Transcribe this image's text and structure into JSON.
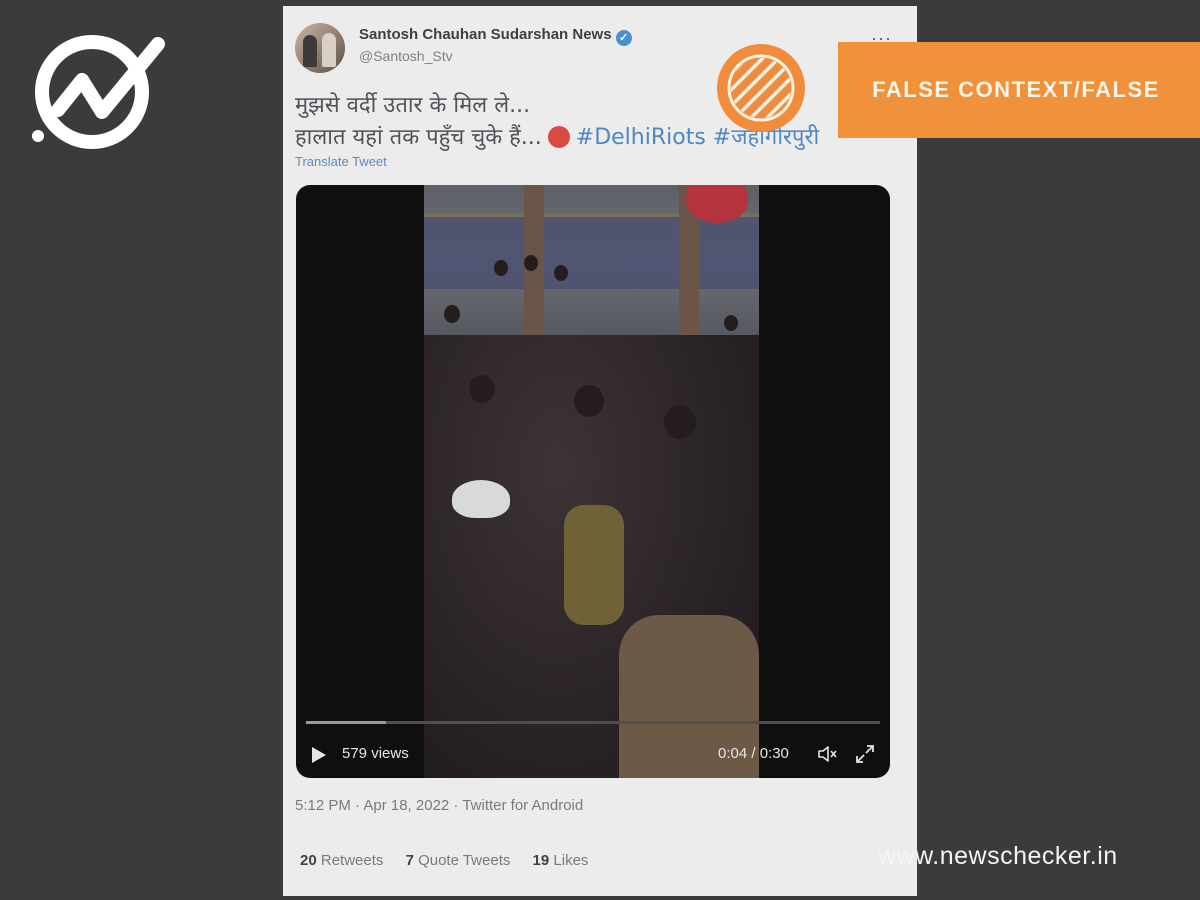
{
  "tweet": {
    "author_name": "Santosh Chauhan Sudarshan News",
    "handle": "@Santosh_Stv",
    "more_label": "···",
    "text_line1": "मुझसे वर्दी उतार के मिल ले...",
    "text_line2": "हालात यहां तक पहुँच चुके हैं...",
    "hashtag1": "#DelhiRiots",
    "hashtag2": "#जहांगीरपुरी",
    "translate_label": "Translate Tweet",
    "video": {
      "views": "579 views",
      "time": "0:04 / 0:30",
      "progress": 0.14
    },
    "meta": "5:12 PM · Apr 18, 2022 · Twitter for Android",
    "stats": {
      "retweets_count": "20",
      "retweets_label": "Retweets",
      "quotes_count": "7",
      "quotes_label": "Quote Tweets",
      "likes_count": "19",
      "likes_label": "Likes"
    }
  },
  "verdict": {
    "label": "FALSE CONTEXT/FALSE",
    "color": "#f0913c"
  },
  "site_url": "www.newschecker.in",
  "icons": [
    "newschecker-logo-icon",
    "verified-icon",
    "play-icon",
    "volume-icon",
    "fullscreen-icon",
    "angry-emoji-icon",
    "verdict-stripes-icon"
  ]
}
